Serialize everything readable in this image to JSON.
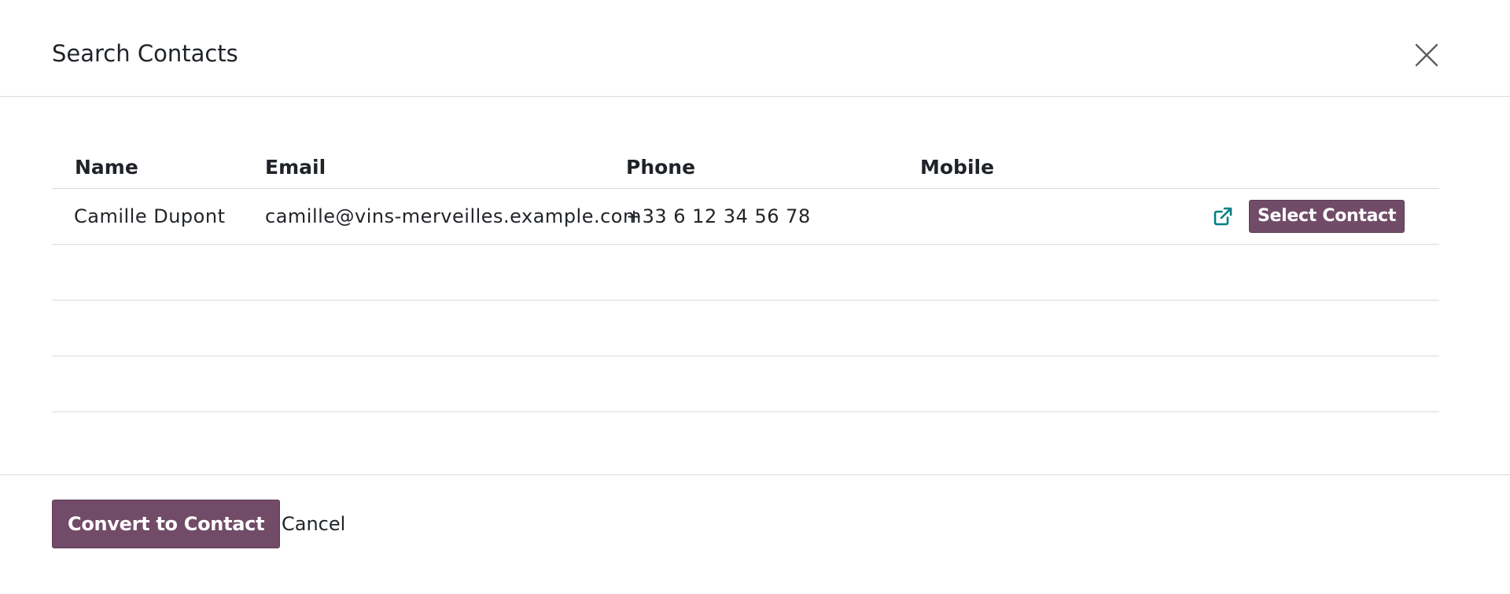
{
  "dialog": {
    "title": "Search Contacts",
    "close_icon": "close-icon"
  },
  "table": {
    "headers": {
      "name": "Name",
      "email": "Email",
      "phone": "Phone",
      "mobile": "Mobile"
    },
    "rows": [
      {
        "name": "Camille Dupont",
        "email": "camille@vins-merveilles.example.com",
        "phone": "+33 6 12 34 56 78",
        "mobile": "",
        "open_icon": "external-link-icon",
        "select_label": "Select Contact"
      }
    ]
  },
  "footer": {
    "convert_label": "Convert to Contact",
    "cancel_label": "Cancel"
  },
  "colors": {
    "primary": "#714b67",
    "link_icon": "#017e84",
    "border": "#d8dadd"
  }
}
